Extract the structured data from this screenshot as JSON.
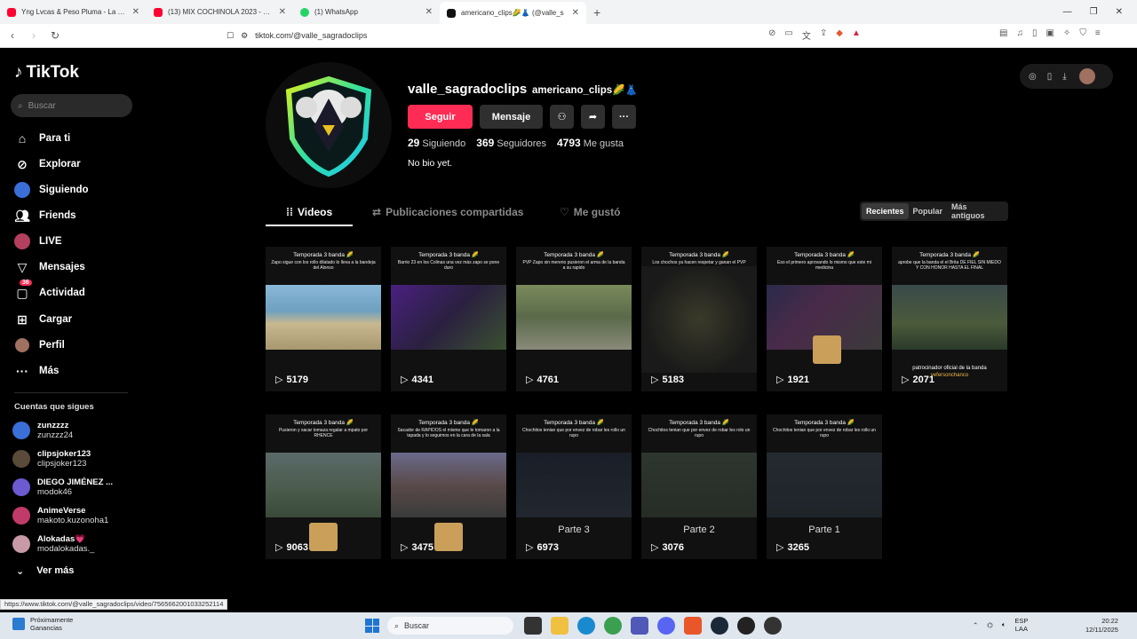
{
  "browser": {
    "tabs": [
      {
        "title": "Yng Lvcas & Peso Pluma - La Bebe (R",
        "color": "#ff0033",
        "active": false
      },
      {
        "title": "(13) MIX COCHINOLA 2023 - DJ LUC",
        "color": "#ff0033",
        "active": false
      },
      {
        "title": "(1) WhatsApp",
        "color": "#25d366",
        "active": false
      },
      {
        "title": "americano_clips🌽👗 (@valle_s",
        "color": "#111111",
        "active": true
      }
    ],
    "new_tab": "+",
    "url": "tiktok.com/@valle_sagradoclips",
    "status_url": "https://www.tiktok.com/@valle_sagradoclips/video/7565662001033252114"
  },
  "sidebar": {
    "logo": "TikTok",
    "search_placeholder": "Buscar",
    "nav": [
      {
        "label": "Para ti",
        "icon": "home-icon"
      },
      {
        "label": "Explorar",
        "icon": "compass-icon"
      },
      {
        "label": "Siguiendo",
        "icon": "following-avatar-icon"
      },
      {
        "label": "Friends",
        "icon": "friends-icon"
      },
      {
        "label": "LIVE",
        "icon": "live-icon"
      },
      {
        "label": "Mensajes",
        "icon": "send-icon"
      },
      {
        "label": "Actividad",
        "icon": "activity-icon",
        "badge": "36"
      },
      {
        "label": "Cargar",
        "icon": "upload-icon"
      },
      {
        "label": "Perfil",
        "icon": "profile-icon"
      },
      {
        "label": "Más",
        "icon": "more-dots-icon"
      }
    ],
    "following_title": "Cuentas que sigues",
    "accounts": [
      {
        "name": "zunzzzz",
        "handle": "zunzzz24",
        "color": "#3a6fd8"
      },
      {
        "name": "clipsjoker123",
        "handle": "clipsjoker123",
        "color": "#5a4a3a"
      },
      {
        "name": "DIEGO JIMÉNEZ ...",
        "handle": "modok46",
        "color": "#6b5ad0"
      },
      {
        "name": "AnimeVerse",
        "handle": "makoto.kuzonoha1",
        "color": "#c03a6a"
      },
      {
        "name": "Alokadas💗",
        "handle": "modalokadas._",
        "color": "#c89aa8"
      }
    ],
    "see_more": "Ver más"
  },
  "profile": {
    "username": "valle_sagradoclips",
    "nickname": "americano_clips🌽👗",
    "follow_label": "Seguir",
    "message_label": "Mensaje",
    "following_count": "29",
    "following_label": "Siguiendo",
    "followers_count": "369",
    "followers_label": "Seguidores",
    "likes_count": "4793",
    "likes_label": "Me gusta",
    "bio": "No bio yet."
  },
  "tabs": {
    "videos": "Videos",
    "reposts": "Publicaciones compartidas",
    "liked": "Me gustó"
  },
  "sort": {
    "recent": "Recientes",
    "popular": "Popular",
    "oldest": "Más antiguos"
  },
  "videos": [
    {
      "title": "Temporada 3 banda 🌽",
      "sub": "Zapo sigue con los rollo dilatado lo lleva a la bandeja del Alonso",
      "views": "5179",
      "thumb": "#5a8fa8"
    },
    {
      "title": "Temporada 3 banda 🌽",
      "sub": "Barrio 23 en los Colinas una vez más zapo se pone duro",
      "views": "4341",
      "thumb": "#3a2060"
    },
    {
      "title": "Temporada 3 banda 🌽",
      "sub": "PVP Zapo sin mereno pusieron el arma de la banda a su rapido",
      "views": "4761",
      "thumb": "#6a7a4a"
    },
    {
      "title": "Temporada 3 banda 🌽",
      "sub": "Los chochos ya hacen respetar y ganan el PVP",
      "views": "5183",
      "thumb": "#1e1e1e"
    },
    {
      "title": "Temporada 3 banda 🌽",
      "sub": "Eso el primero aprovando lo mismo que este mi medicina",
      "views": "1921",
      "thumb": "#2a2a3a"
    },
    {
      "title": "Temporada 3 banda 🌽",
      "sub": "aprobe que la banda el el Brita DE FIEL SIN MIEDO Y CON HONOR HASTA EL FINAL",
      "views": "2071",
      "thumb": "#3a4a3a",
      "sponsor": "patrocinador oficial de la banda",
      "sponsor_name": "yefersonchanco"
    },
    {
      "title": "Temporada 3 banda 🌽",
      "sub": "Pusieron y sacar tomaza regalar a mpato por RHENCE",
      "views": "9063",
      "thumb": "#4a5a4a"
    },
    {
      "title": "Temporada 3 banda 🌽",
      "sub": "Sacador de RAPIDOS el mismo que le tomaron a la tapada y lo seguimos en la cara de la sala",
      "views": "3475",
      "thumb": "#4a4a55"
    },
    {
      "title": "Temporada 3 banda 🌽",
      "sub": "Chochitos tenian que por envez de robar les rollo un rupo",
      "views": "6973",
      "thumb": "#151a22",
      "parte": "Parte 3"
    },
    {
      "title": "Temporada 3 banda 🌽",
      "sub": "Chochitos tenian que por envez de robar les rolo un rupo",
      "views": "3076",
      "thumb": "#2a3028",
      "parte": "Parte 2"
    },
    {
      "title": "Temporada 3 banda 🌽",
      "sub": "Chochitos tenian que por envez de robar les rollo un rupo",
      "views": "3265",
      "thumb": "#1e242a",
      "parte": "Parte 1"
    }
  ],
  "taskbar": {
    "weather_title": "Próximamente",
    "weather_sub": "Ganancias",
    "search": "Buscar",
    "lang1": "ESP",
    "lang2": "LAA",
    "time": "20:22",
    "date": "12/11/2025"
  }
}
